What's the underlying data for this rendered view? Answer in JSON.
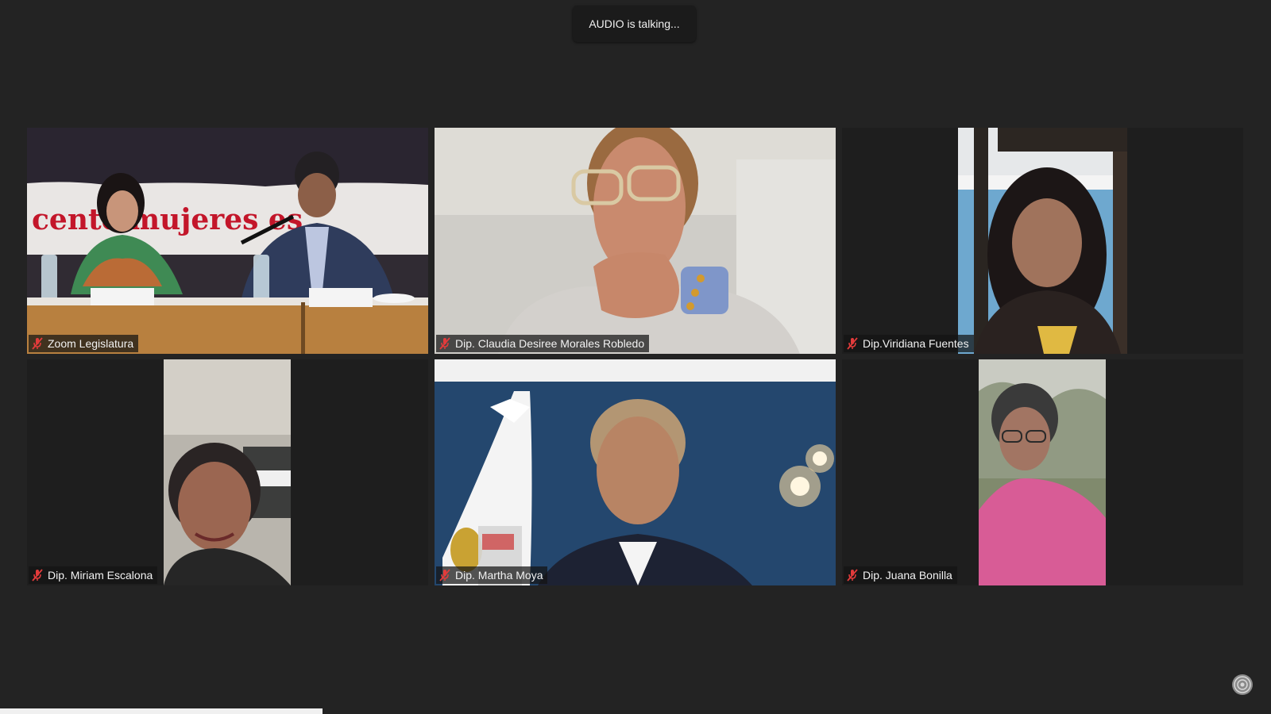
{
  "status": {
    "talking_text": "AUDIO is talking..."
  },
  "participants": [
    {
      "name": "Zoom Legislatura",
      "muted": true,
      "icon": "mic-muted-icon"
    },
    {
      "name": "Dip. Claudia Desiree Morales Robledo",
      "muted": true,
      "icon": "mic-muted-icon"
    },
    {
      "name": "Dip.Viridiana Fuentes",
      "muted": true,
      "icon": "mic-muted-icon"
    },
    {
      "name": "Dip. Miriam Escalona",
      "muted": true,
      "icon": "mic-muted-icon"
    },
    {
      "name": "Dip. Martha Moya",
      "muted": true,
      "icon": "mic-muted-icon"
    },
    {
      "name": "Dip. Juana Bonilla",
      "muted": true,
      "icon": "mic-muted-icon"
    }
  ],
  "banner_text": "cente mujeres es",
  "colors": {
    "background": "#232323",
    "tile": "#1e1e1e",
    "muted_icon": "#e23b3b",
    "namebar": "rgba(20,20,20,0.72)"
  },
  "icons": {
    "settings": "settings-icon"
  }
}
